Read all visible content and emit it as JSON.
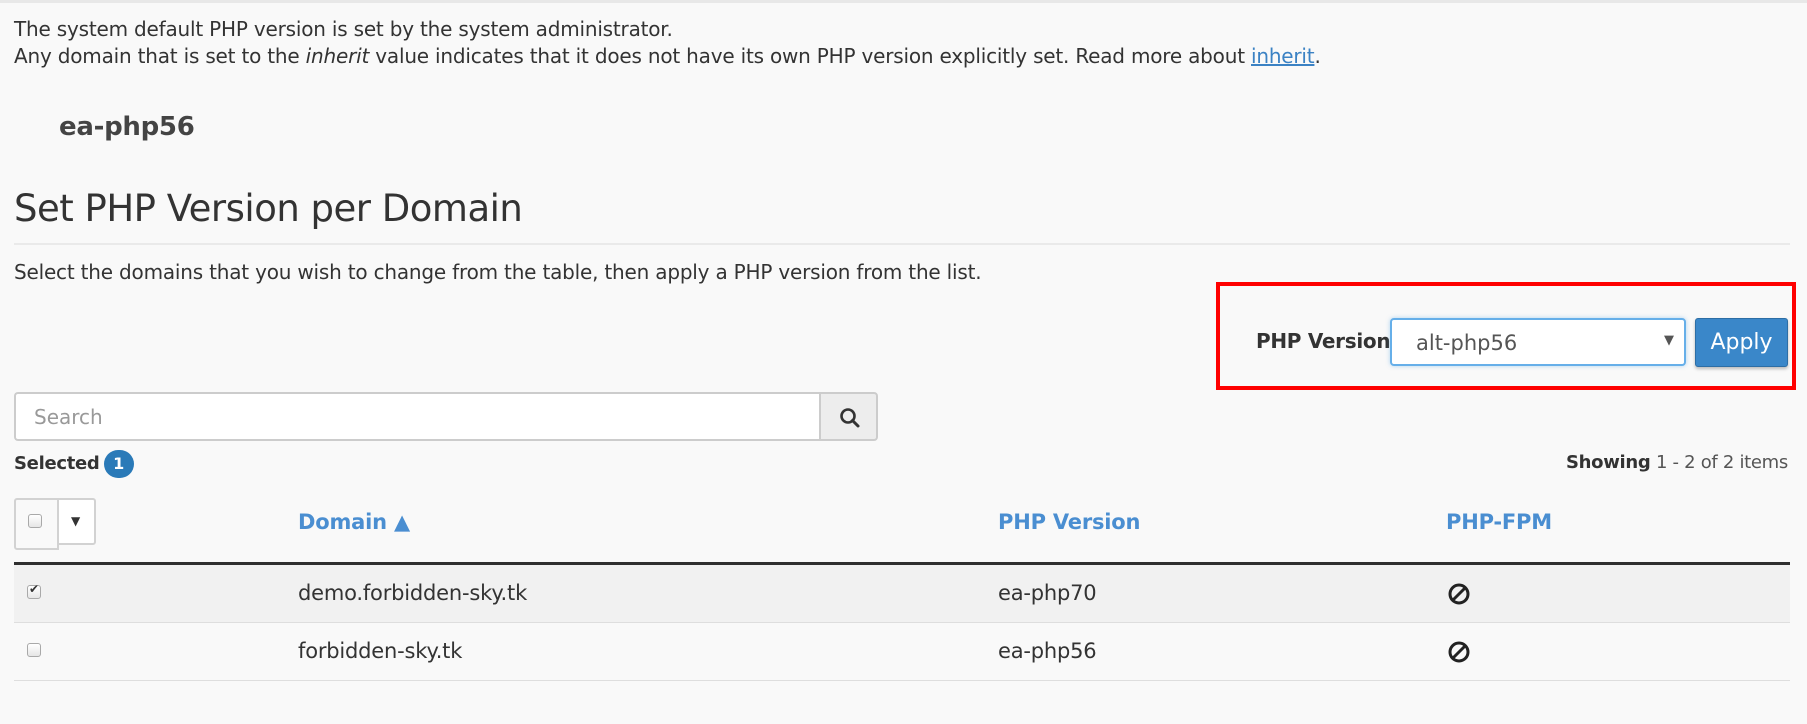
{
  "intro": {
    "line1": "The system default PHP version is set by the system administrator.",
    "line2_before": "Any domain that is set to the ",
    "line2_em": "inherit",
    "line2_after": " value indicates that it does not have its own PHP version explicitly set. Read more about ",
    "link_label": "inherit",
    "line2_end": "."
  },
  "system_default_version": "ea-php56",
  "section": {
    "title": "Set PHP Version per Domain",
    "description": "Select the domains that you wish to change from the table, then apply a PHP version from the list."
  },
  "version_picker": {
    "label": "PHP Version",
    "selected": "alt-php56",
    "apply_label": "Apply",
    "highlight_color": "#ff0000"
  },
  "search": {
    "placeholder": "Search",
    "value": ""
  },
  "selection": {
    "label": "Selected",
    "count": "1"
  },
  "pagination": {
    "prefix": "Showing",
    "range": "1 - 2 of 2 items"
  },
  "table": {
    "columns": [
      "Domain ▲",
      "PHP Version",
      "PHP-FPM"
    ],
    "rows": [
      {
        "checked": true,
        "domain": "demo.forbidden-sky.tk",
        "php_version": "ea-php70",
        "php_fpm": "disabled"
      },
      {
        "checked": false,
        "domain": "forbidden-sky.tk",
        "php_version": "ea-php56",
        "php_fpm": "disabled"
      }
    ]
  },
  "colors": {
    "accent": "#3a87c9",
    "link": "#4a8ed1",
    "badge": "#2a7ab8"
  }
}
